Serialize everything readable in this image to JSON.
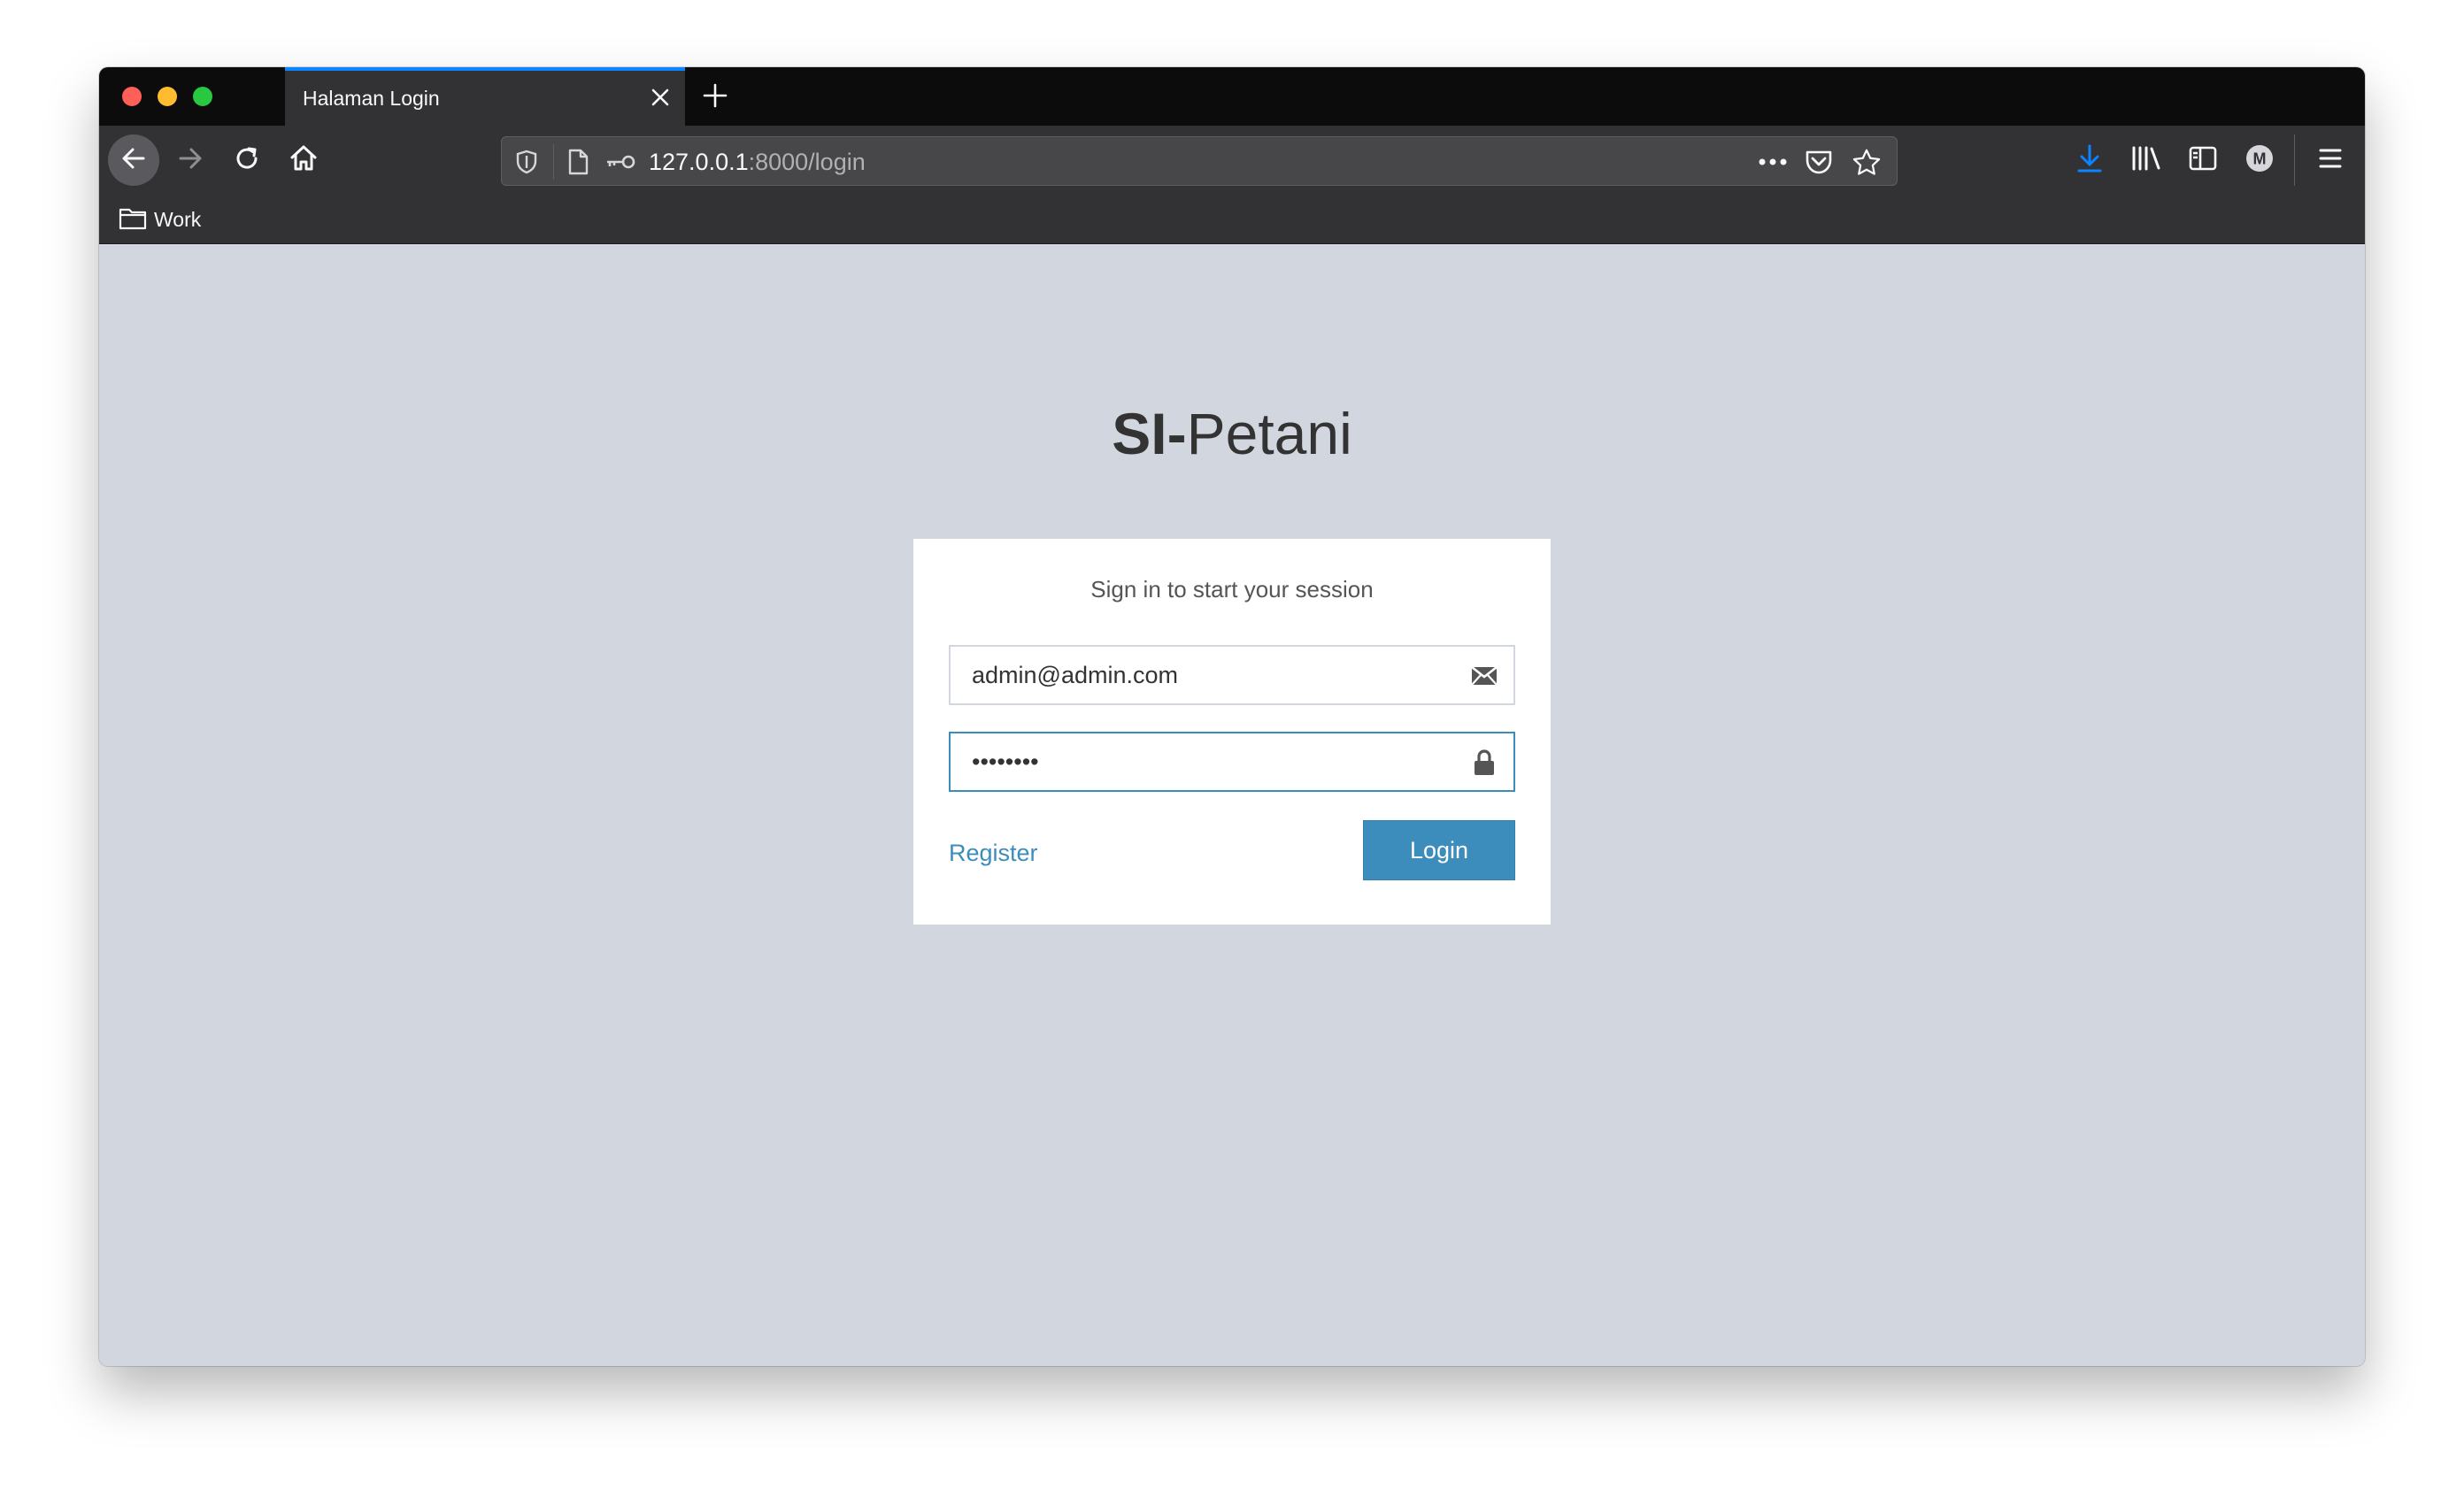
{
  "browser": {
    "tab_title": "Halaman Login",
    "url_host": "127.0.0.1",
    "url_path": ":8000/login",
    "bookmarks": [
      {
        "label": "Work"
      }
    ],
    "colors": {
      "accent": "#0a84ff",
      "download_icon": "#0a84ff"
    },
    "icons": {
      "back": "arrow-left-icon",
      "forward": "arrow-right-icon",
      "reload": "reload-icon",
      "home": "home-icon",
      "tracking": "shield-icon",
      "page": "page-icon",
      "permissions": "key-icon",
      "page_actions": "more-dots-icon",
      "pocket": "pocket-icon",
      "bookmark": "star-icon",
      "downloads": "download-icon",
      "library": "library-icon",
      "sidebar": "sidebar-icon",
      "account": "account-icon",
      "menu": "hamburger-menu-icon"
    },
    "account_initial": "M"
  },
  "page": {
    "brand_bold": "SI-",
    "brand_light": "Petani",
    "login_box_msg": "Sign in to start your session",
    "email": {
      "value": "admin@admin.com"
    },
    "password": {
      "value": "••••••••"
    },
    "register_label": "Register",
    "login_label": "Login",
    "colors": {
      "background": "#d2d6de",
      "primary": "#3c8dbc"
    }
  }
}
